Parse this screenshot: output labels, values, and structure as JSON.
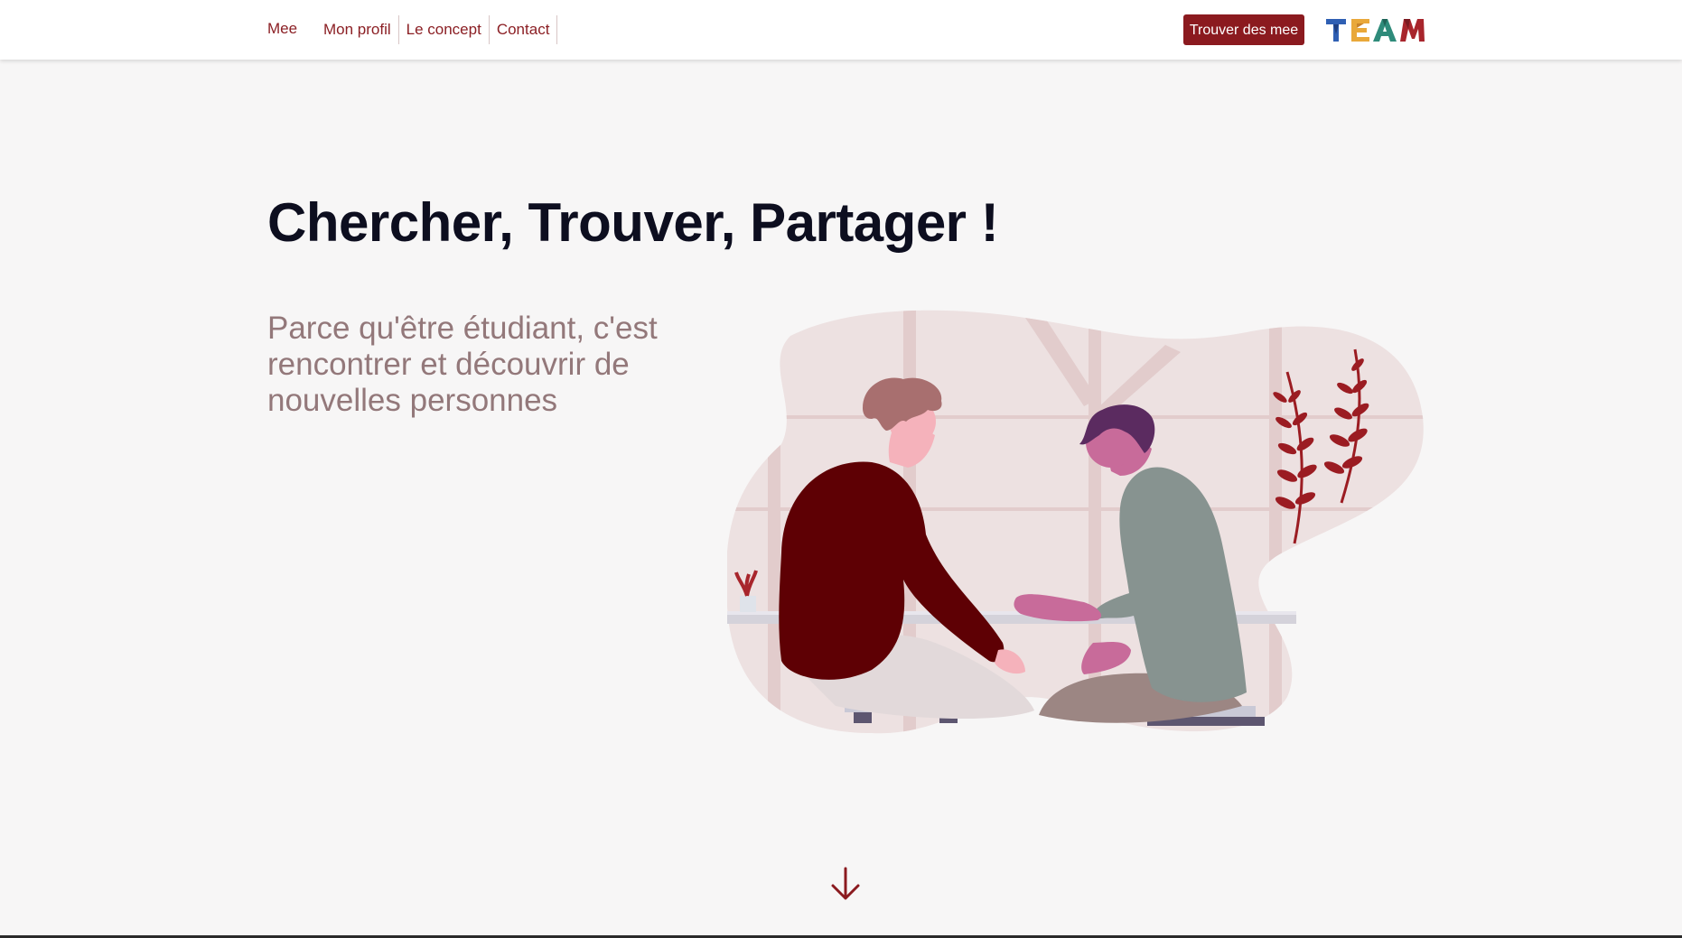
{
  "navbar": {
    "brand": "Mee",
    "links": [
      "Mon profil",
      "Le concept",
      "Contact"
    ],
    "cta_label": "Trouver des mee",
    "logo_text": "TEAM",
    "logo_colors": [
      "#2f5fb3",
      "#e9a83a",
      "#2e8b7a",
      "#a8252c"
    ]
  },
  "hero": {
    "title": "Chercher, Trouver, Partager !",
    "subtitle": "Parce qu'être étudiant, c'est rencontrer et découvrir de nouvelles personnes"
  },
  "illustration": {
    "icon": "two-people-talking-illustration"
  },
  "scroll": {
    "icon": "arrow-down-icon"
  },
  "colors": {
    "accent": "#8b1a1f",
    "title": "#0d0e1f",
    "subtitle": "#93787a",
    "background": "#f7f6f6"
  }
}
